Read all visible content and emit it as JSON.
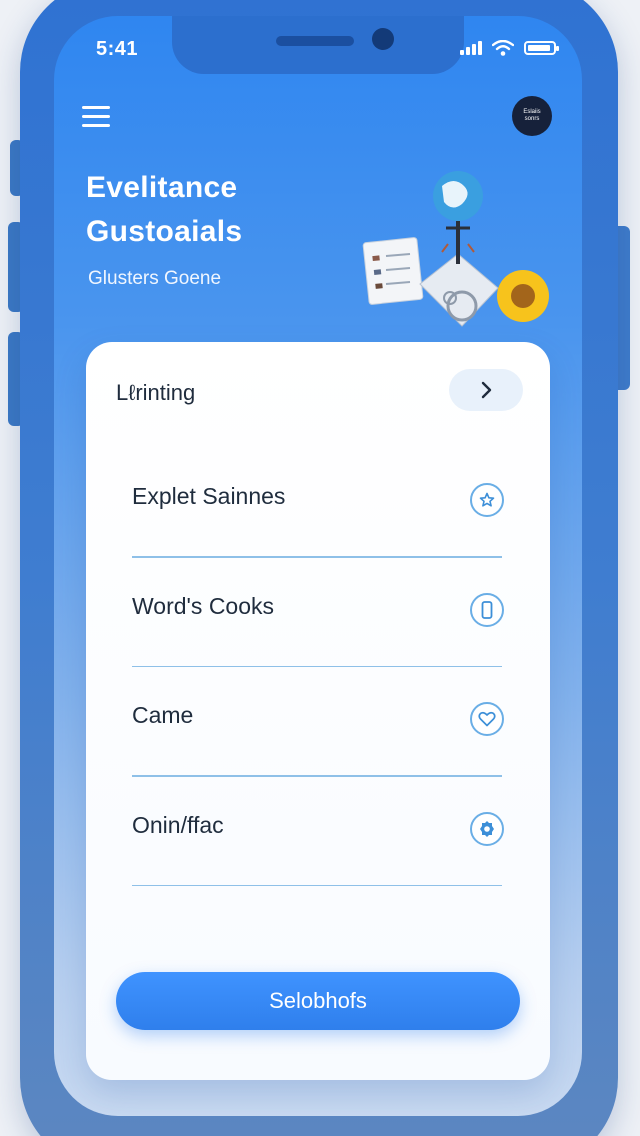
{
  "status_bar": {
    "time": "5:41"
  },
  "header": {
    "avatar_text": "Eslaiis sonrs",
    "title_line1": "Evelitance",
    "title_line2": "Gustoaials",
    "subtitle": "Glusters Goene"
  },
  "card": {
    "header_title": "Lℓrinting",
    "items": [
      {
        "label": "Explet Sainnes",
        "icon": "star-icon"
      },
      {
        "label": "Word's Cooks",
        "icon": "phone-icon"
      },
      {
        "label": "Came",
        "icon": "heart-icon"
      },
      {
        "label": "Onin/ffac",
        "icon": "gear-icon"
      }
    ],
    "primary_button_label": "Selobhofs"
  },
  "colors": {
    "accent": "#2f7fec",
    "screen_top": "#2f86f0",
    "icon_ring": "#6aaee6",
    "text_dark": "#1f2c3d"
  }
}
